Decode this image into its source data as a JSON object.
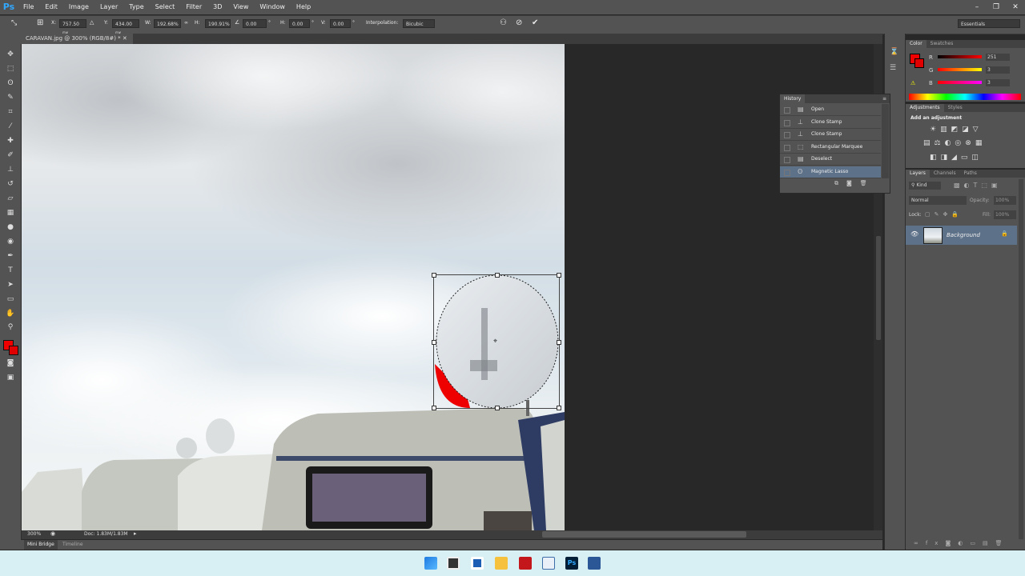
{
  "app": {
    "logo": "Ps"
  },
  "menu": [
    "File",
    "Edit",
    "Image",
    "Layer",
    "Type",
    "Select",
    "Filter",
    "3D",
    "View",
    "Window",
    "Help"
  ],
  "window_controls": {
    "minimize": "–",
    "restore": "❐",
    "close": "✕"
  },
  "options": {
    "x_label": "X:",
    "x_value": "757.50 px",
    "y_label": "Y:",
    "y_value": "434.00 px",
    "w_label": "W:",
    "w_value": "192.68%",
    "h_label": "H:",
    "h_value": "190.91%",
    "angle_value": "0.00",
    "deg1": "°",
    "hskew_label": "H:",
    "hskew_value": "0.00",
    "deg2": "°",
    "vskew_label": "V:",
    "vskew_value": "0.00",
    "deg3": "°",
    "interp_label": "Interpolation:",
    "interp_value": "Bicubic",
    "workspace": "Essentials"
  },
  "document": {
    "tab_title": "CARAVAN.jpg @ 300% (RGB/8#) *",
    "zoom": "300%",
    "doc_info": "Doc: 1.83M/1.83M"
  },
  "bottom_tabs": [
    "Mini Bridge",
    "Timeline"
  ],
  "color_panel": {
    "tabs": [
      "Color",
      "Swatches"
    ],
    "r_label": "R",
    "r_value": "251",
    "g_label": "G",
    "g_value": "3",
    "b_label": "B",
    "b_value": "3",
    "fg_color": "#fb0303"
  },
  "adjustments_panel": {
    "tabs": [
      "Adjustments",
      "Styles"
    ],
    "heading": "Add an adjustment"
  },
  "layers_panel": {
    "tabs": [
      "Layers",
      "Channels",
      "Paths"
    ],
    "kind": "Kind",
    "blend": "Normal",
    "opacity_label": "Opacity:",
    "opacity_value": "100%",
    "lock_label": "Lock:",
    "fill_label": "Fill:",
    "fill_value": "100%",
    "layer_name": "Background"
  },
  "history": {
    "title": "History",
    "items": [
      {
        "label": "Open",
        "icon": "document-icon"
      },
      {
        "label": "Clone Stamp",
        "icon": "stamp-icon"
      },
      {
        "label": "Clone Stamp",
        "icon": "stamp-icon"
      },
      {
        "label": "Rectangular Marquee",
        "icon": "marquee-icon"
      },
      {
        "label": "Deselect",
        "icon": "document-icon"
      },
      {
        "label": "Magnetic Lasso",
        "icon": "lasso-icon"
      }
    ],
    "selected_index": 5
  },
  "colors": {
    "accent": "#31a8ff",
    "history_selected": "#5d7189",
    "panel": "#535353"
  }
}
